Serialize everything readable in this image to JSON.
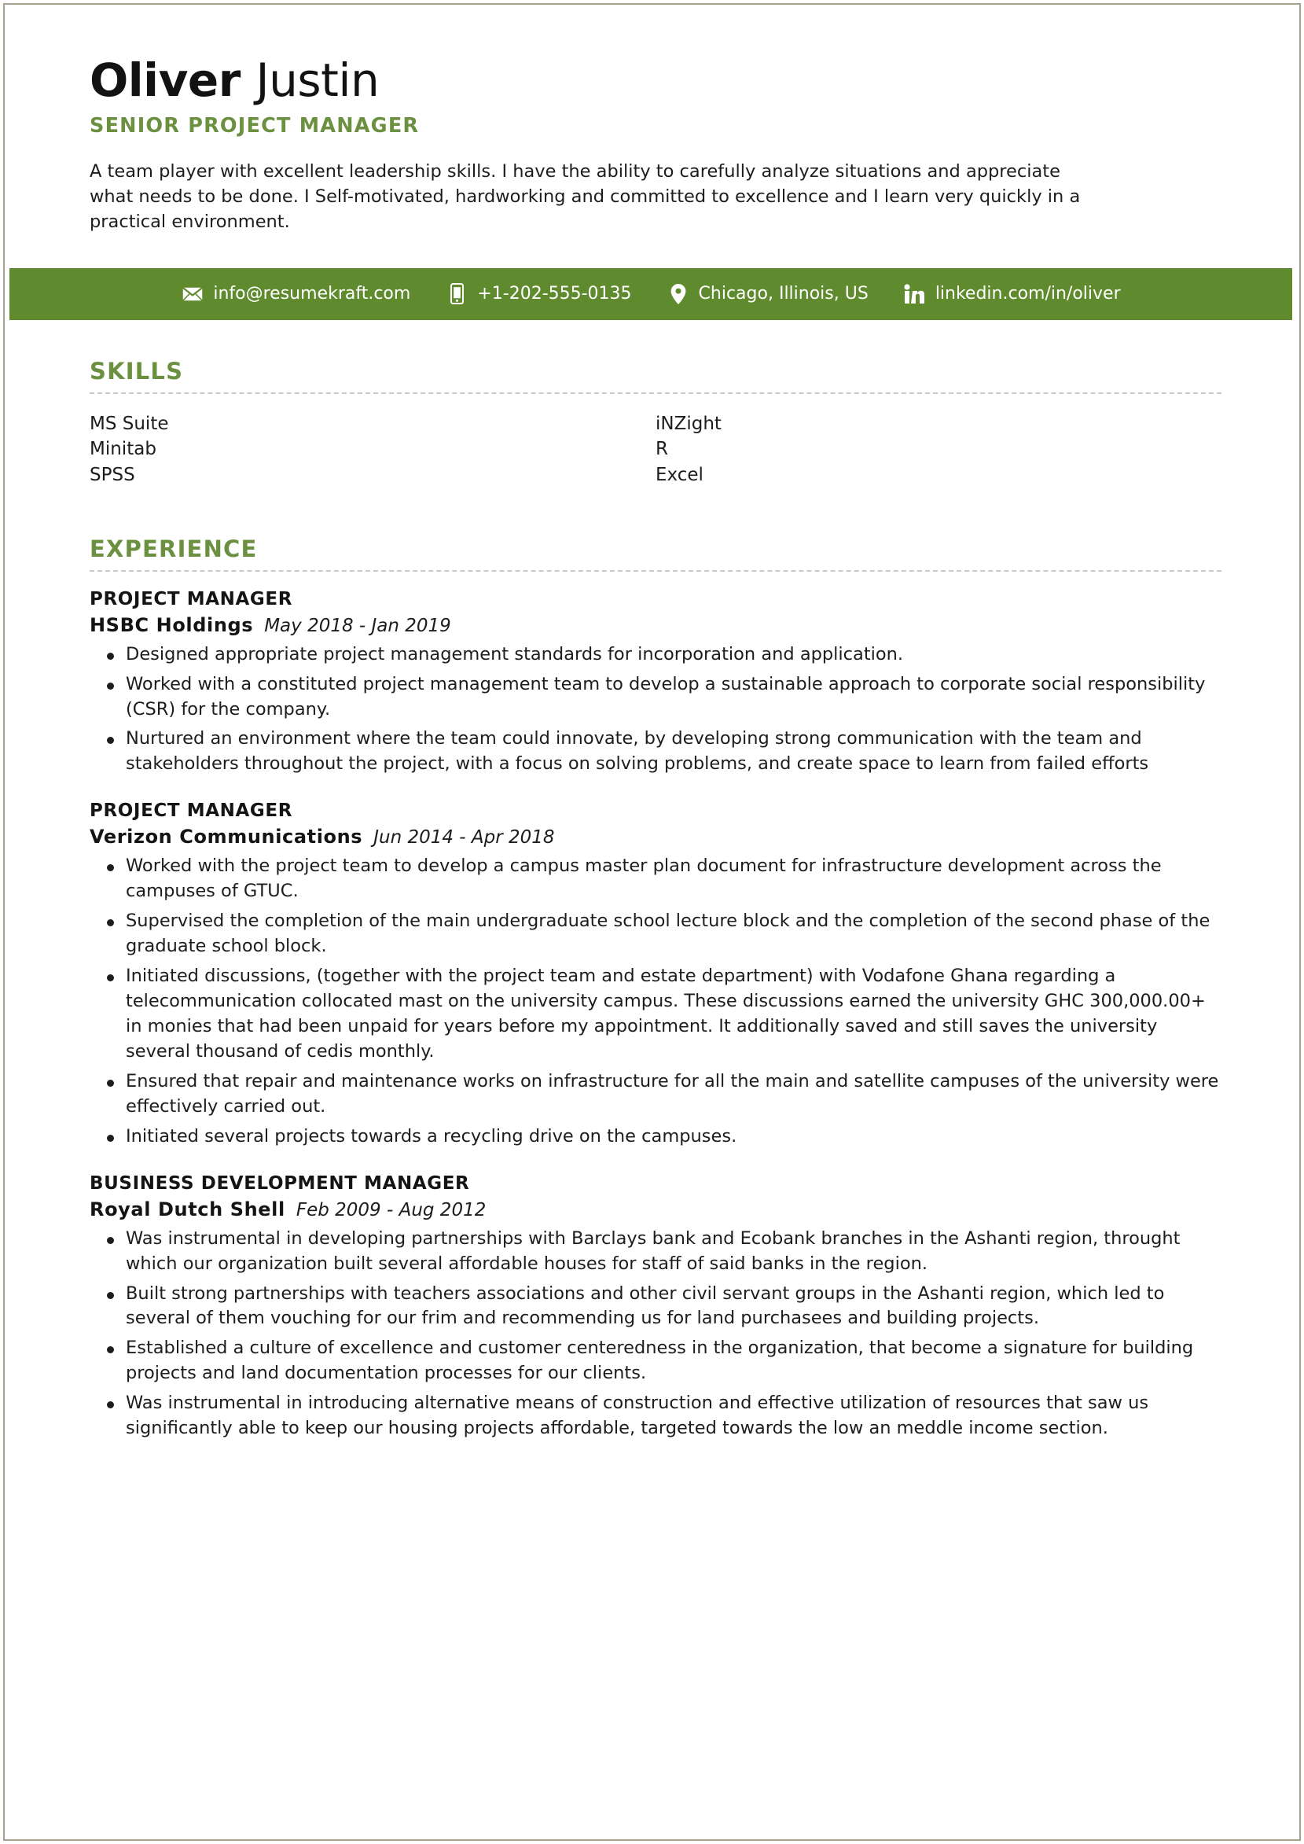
{
  "theme": {
    "accent_green": "#5f8b2e",
    "heading_green": "#6b9040",
    "text_color": "#1d1d1d",
    "border_color": "#a7a28d"
  },
  "header": {
    "first_name": "Oliver",
    "last_name": "Justin",
    "job_title": "SENIOR PROJECT MANAGER",
    "summary": "A team player with excellent leadership skills. I have the ability to carefully analyze situations and appreciate what needs to be done. I Self-motivated, hardworking and committed to excellence and I learn very quickly in a practical environment."
  },
  "contact": {
    "items": [
      {
        "icon": "envelope-icon",
        "label": "info@resumekraft.com",
        "name": "contact-email"
      },
      {
        "icon": "phone-icon",
        "label": "+1-202-555-0135",
        "name": "contact-phone"
      },
      {
        "icon": "location-pin-icon",
        "label": "Chicago, Illinois, US",
        "name": "contact-location"
      },
      {
        "icon": "linkedin-icon",
        "label": "linkedin.com/in/oliver",
        "name": "contact-linkedin"
      }
    ]
  },
  "skills": {
    "title": "SKILLS",
    "column_left": [
      "MS Suite",
      "Minitab",
      "SPSS"
    ],
    "column_right": [
      "iNZight",
      "R",
      "Excel"
    ]
  },
  "experience": {
    "title": "EXPERIENCE",
    "entries": [
      {
        "role": "PROJECT MANAGER",
        "company": "HSBC Holdings",
        "dates": "May 2018 - Jan 2019",
        "bullets": [
          "Designed appropriate project management standards for incorporation and application.",
          "Worked with a constituted project management team to develop a sustainable approach to corporate social responsibility (CSR) for the company.",
          "Nurtured an environment where the team could innovate, by developing strong communication with the team and stakeholders throughout the project, with a focus on solving problems, and create space to learn from failed efforts"
        ]
      },
      {
        "role": "PROJECT MANAGER",
        "company": "Verizon Communications",
        "dates": "Jun 2014 - Apr 2018",
        "bullets": [
          "Worked with the project team to develop a campus master plan document for infrastructure development across the campuses of GTUC.",
          "Supervised the completion of the main undergraduate school lecture block and the completion of the second phase of the graduate school block.",
          "Initiated discussions, (together with the project team and estate department) with Vodafone Ghana regarding a telecommunication collocated mast on the university campus. These discussions earned the university GHC 300,000.00+ in monies that had been unpaid for years before my appointment. It additionally saved and still saves the university several thousand of cedis monthly.",
          "Ensured that repair and maintenance works on infrastructure for all the main and satellite campuses of the university were effectively carried out.",
          "Initiated several projects towards a recycling drive on the campuses."
        ]
      },
      {
        "role": "BUSINESS DEVELOPMENT MANAGER",
        "company": "Royal Dutch Shell",
        "dates": "Feb 2009 - Aug 2012",
        "bullets": [
          "Was instrumental in developing partnerships with Barclays bank and Ecobank branches in the Ashanti region, throught which our organization built several affordable houses for staff of said banks in the region.",
          "Built strong partnerships with teachers associations and other civil servant groups in the Ashanti region, which led to several of them vouching for our frim and recommending us for land purchasees and building projects.",
          "Established a culture of excellence and customer centeredness in the organization, that become a signature for building projects and land documentation processes for our clients.",
          "Was instrumental in introducing alternative means of construction and effective utilization of resources that saw us significantly able to keep our housing projects affordable, targeted towards the low an meddle income section."
        ]
      }
    ]
  }
}
